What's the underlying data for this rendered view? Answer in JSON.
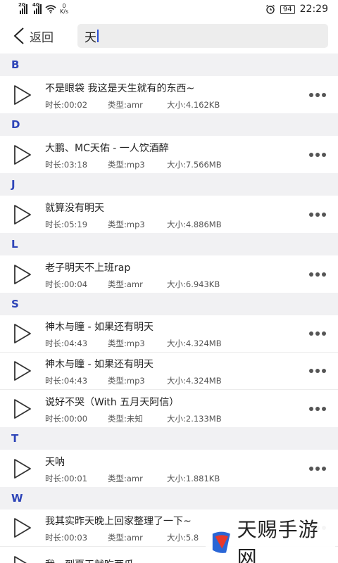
{
  "status_bar": {
    "network1": "2G",
    "network2": "4G",
    "speed_value": "0",
    "speed_unit": "K/s",
    "battery": "94",
    "time": "22:29"
  },
  "header": {
    "back_label": "返回",
    "search_value": "天"
  },
  "sections": [
    {
      "letter": "B",
      "items": [
        {
          "title": "不是眼袋 我这是天生就有的东西~",
          "duration": "时长:00:02",
          "type": "类型:amr",
          "size": "大小:4.162KB"
        }
      ]
    },
    {
      "letter": "D",
      "items": [
        {
          "title": "大鹏、MC天佑 - 一人饮酒醉",
          "duration": "时长:03:18",
          "type": "类型:mp3",
          "size": "大小:7.566MB"
        }
      ]
    },
    {
      "letter": "J",
      "items": [
        {
          "title": "就算没有明天",
          "duration": "时长:05:19",
          "type": "类型:mp3",
          "size": "大小:4.886MB"
        }
      ]
    },
    {
      "letter": "L",
      "items": [
        {
          "title": "老子明天不上班rap",
          "duration": "时长:00:04",
          "type": "类型:amr",
          "size": "大小:6.943KB"
        }
      ]
    },
    {
      "letter": "S",
      "items": [
        {
          "title": "神木与瞳 - 如果还有明天",
          "duration": "时长:04:43",
          "type": "类型:mp3",
          "size": "大小:4.324MB"
        },
        {
          "title": "神木与瞳 - 如果还有明天",
          "duration": "时长:04:43",
          "type": "类型:mp3",
          "size": "大小:4.324MB"
        },
        {
          "title": "说好不哭（With 五月天阿信）",
          "duration": "时长:00:00",
          "type": "类型:未知",
          "size": "大小:2.133MB"
        }
      ]
    },
    {
      "letter": "T",
      "items": [
        {
          "title": "天呐",
          "duration": "时长:00:01",
          "type": "类型:amr",
          "size": "大小:1.881KB"
        }
      ]
    },
    {
      "letter": "W",
      "items": [
        {
          "title": "我其实昨天晚上回家整理了一下~",
          "duration": "时长:00:03",
          "type": "类型:amr",
          "size": "大小:5.8"
        },
        {
          "title": "我一到夏天就吃西瓜~",
          "duration": "",
          "type": "",
          "size": ""
        }
      ]
    }
  ],
  "watermark": {
    "text": "天赐手游网"
  },
  "colors": {
    "section_letter": "#2e45b8",
    "caret": "#2a4fd6",
    "background": "#f1f1f3",
    "watermark_red": "#e8382b",
    "watermark_blue": "#2a66d6"
  }
}
